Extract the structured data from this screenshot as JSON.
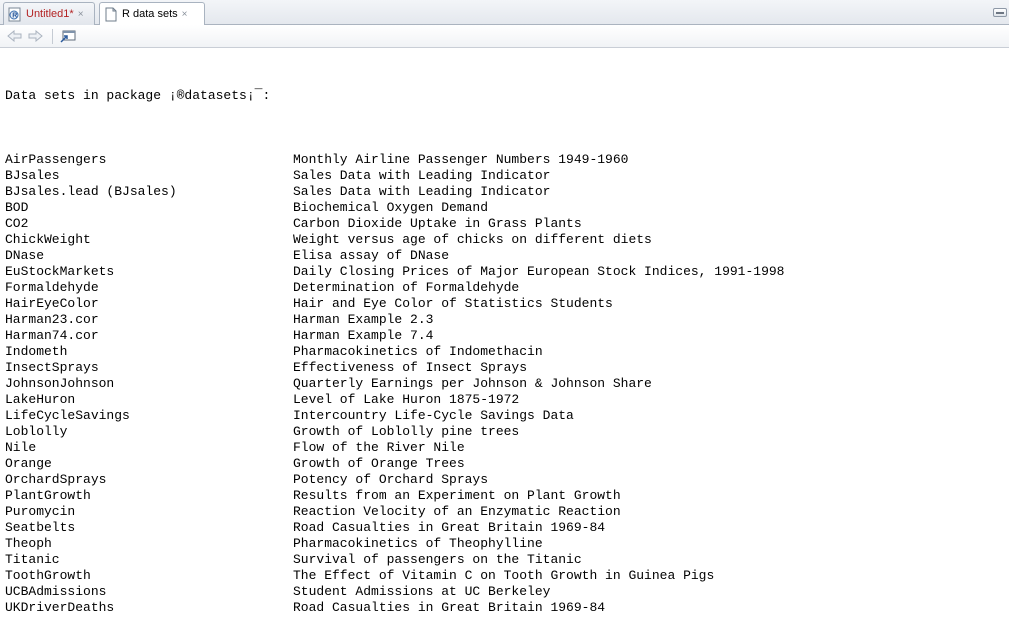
{
  "tabs": [
    {
      "label": "Untitled1*",
      "close": "×",
      "active": false,
      "icon": "r-script-icon"
    },
    {
      "label": "R data sets",
      "close": "×",
      "active": true,
      "icon": "document-icon"
    }
  ],
  "toolbar": {
    "back": "back-arrow-icon",
    "forward": "forward-arrow-icon",
    "show_in_window": "show-in-new-window-icon"
  },
  "content": {
    "heading": "Data sets in package ¡®datasets¡¯:",
    "datasets": [
      {
        "name": "AirPassengers",
        "description": "Monthly Airline Passenger Numbers 1949-1960"
      },
      {
        "name": "BJsales",
        "description": "Sales Data with Leading Indicator"
      },
      {
        "name": "BJsales.lead (BJsales)",
        "description": "Sales Data with Leading Indicator"
      },
      {
        "name": "BOD",
        "description": "Biochemical Oxygen Demand"
      },
      {
        "name": "CO2",
        "description": "Carbon Dioxide Uptake in Grass Plants"
      },
      {
        "name": "ChickWeight",
        "description": "Weight versus age of chicks on different diets"
      },
      {
        "name": "DNase",
        "description": "Elisa assay of DNase"
      },
      {
        "name": "EuStockMarkets",
        "description": "Daily Closing Prices of Major European Stock Indices, 1991-1998"
      },
      {
        "name": "Formaldehyde",
        "description": "Determination of Formaldehyde"
      },
      {
        "name": "HairEyeColor",
        "description": "Hair and Eye Color of Statistics Students"
      },
      {
        "name": "Harman23.cor",
        "description": "Harman Example 2.3"
      },
      {
        "name": "Harman74.cor",
        "description": "Harman Example 7.4"
      },
      {
        "name": "Indometh",
        "description": "Pharmacokinetics of Indomethacin"
      },
      {
        "name": "InsectSprays",
        "description": "Effectiveness of Insect Sprays"
      },
      {
        "name": "JohnsonJohnson",
        "description": "Quarterly Earnings per Johnson & Johnson Share"
      },
      {
        "name": "LakeHuron",
        "description": "Level of Lake Huron 1875-1972"
      },
      {
        "name": "LifeCycleSavings",
        "description": "Intercountry Life-Cycle Savings Data"
      },
      {
        "name": "Loblolly",
        "description": "Growth of Loblolly pine trees"
      },
      {
        "name": "Nile",
        "description": "Flow of the River Nile"
      },
      {
        "name": "Orange",
        "description": "Growth of Orange Trees"
      },
      {
        "name": "OrchardSprays",
        "description": "Potency of Orchard Sprays"
      },
      {
        "name": "PlantGrowth",
        "description": "Results from an Experiment on Plant Growth"
      },
      {
        "name": "Puromycin",
        "description": "Reaction Velocity of an Enzymatic Reaction"
      },
      {
        "name": "Seatbelts",
        "description": "Road Casualties in Great Britain 1969-84"
      },
      {
        "name": "Theoph",
        "description": "Pharmacokinetics of Theophylline"
      },
      {
        "name": "Titanic",
        "description": "Survival of passengers on the Titanic"
      },
      {
        "name": "ToothGrowth",
        "description": "The Effect of Vitamin C on Tooth Growth in Guinea Pigs"
      },
      {
        "name": "UCBAdmissions",
        "description": "Student Admissions at UC Berkeley"
      },
      {
        "name": "UKDriverDeaths",
        "description": "Road Casualties in Great Britain 1969-84"
      }
    ]
  },
  "colors": {
    "inactive_tab_text": "#b22222",
    "active_tab_text": "#000000",
    "content_text": "#000000"
  }
}
